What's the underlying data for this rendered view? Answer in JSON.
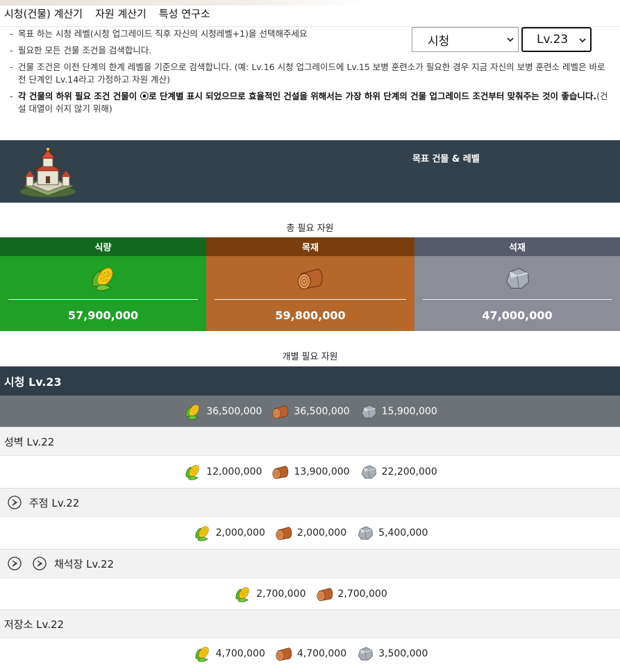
{
  "nav": {
    "items": [
      "시청(건물) 계산기",
      "자원 계산기",
      "특성 연구소"
    ]
  },
  "notes": [
    "목표 하는 시청 레벨(시청 업그레이드 직후 자신의 시청레벨+1)을 선택해주세요",
    "필요한 모든 건물 조건을 검색합니다.",
    "건물 조건은 이전 단계의 한계 레벨을 기준으로 검색합니다. (예: Lv.16 시청 업그레이드에 Lv.15 보병 훈련소가 필요한 경우 지금 자신의 보병 훈련소 레벨은 바로 전 단계인 Lv.14라고 가정하고 자원 계산)"
  ],
  "note_bold": {
    "bold": "각 건물의 하위 필요 조건 건물이 ⦿로 단계별 표시 되었으므로 효율적인 건설을 위해서는 가장 하위 단계의 건물 업그레이드 조건부터 맞춰주는 것이 좋습니다.",
    "rest": "(건설 대열이 쉬지 않기 위해)"
  },
  "target": {
    "label": "목표 건물 & 레벨",
    "building": "시청",
    "level": "Lv.23"
  },
  "totals": {
    "title": "총 필요 자원",
    "food": {
      "label": "식량",
      "value": "57,900,000"
    },
    "wood": {
      "label": "목재",
      "value": "59,800,000"
    },
    "stone": {
      "label": "석재",
      "value": "47,000,000"
    }
  },
  "individual": {
    "title": "개별 필요 자원",
    "main": {
      "name": "시청 Lv.23",
      "food": "36,500,000",
      "wood": "36,500,000",
      "stone": "15,900,000"
    },
    "buildings": [
      {
        "name": "성벽 Lv.22",
        "food": "12,000,000",
        "wood": "13,900,000",
        "stone": "22,200,000"
      },
      {
        "name": "주점 Lv.22",
        "food": "2,000,000",
        "wood": "2,000,000",
        "stone": "5,400,000"
      },
      {
        "name": "채석장 Lv.22",
        "food": "2,700,000",
        "wood": "2,700,000"
      },
      {
        "name": "저장소 Lv.22",
        "food": "4,700,000",
        "wood": "4,700,000",
        "stone": "3,500,000"
      }
    ]
  },
  "colors": {
    "dark_header": "#2f3e49",
    "food": "#1ea125",
    "wood": "#b5682a",
    "stone": "#8d8d99"
  },
  "icons": [
    "castle-icon",
    "corn-icon",
    "wood-log-icon",
    "stone-icon",
    "arrow-circle-icon",
    "chevron-down-icon"
  ]
}
